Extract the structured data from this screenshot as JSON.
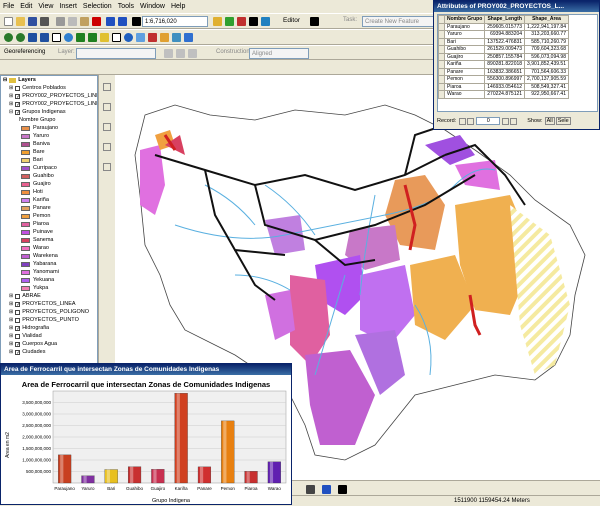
{
  "menu": [
    "File",
    "Edit",
    "View",
    "Insert",
    "Selection",
    "Tools",
    "Window",
    "Help"
  ],
  "toolbar": {
    "scale": "1:6,716,020",
    "editor": "Editor",
    "task": "Task:",
    "task_value": "Create New Feature",
    "georef": "Georeferencing",
    "layer": "Layer:",
    "construction": "Construction:",
    "construction_value": "Aligned"
  },
  "toc": {
    "layers_label": "Layers",
    "items": [
      {
        "label": "Centros Poblados",
        "checked": false
      },
      {
        "label": "PROY002_PROYECTOS_LINE",
        "checked": true
      },
      {
        "label": "PROY002_PROYECTOS_LINE",
        "checked": true
      },
      {
        "label": "Grupos Indigenas",
        "checked": true
      }
    ],
    "legend_field": "Nombre Grupo",
    "legend": [
      {
        "label": "Paraujano",
        "color": "#e8904a"
      },
      {
        "label": "Yaruro",
        "color": "#c878c8"
      },
      {
        "label": "Baniva",
        "color": "#b05090"
      },
      {
        "label": "Bare",
        "color": "#f0a030"
      },
      {
        "label": "Bari",
        "color": "#f0d070"
      },
      {
        "label": "Curripaco",
        "color": "#a050c8"
      },
      {
        "label": "Guahibo",
        "color": "#d06060"
      },
      {
        "label": "Guajiro",
        "color": "#e86090"
      },
      {
        "label": "Hoti",
        "color": "#f09040"
      },
      {
        "label": "Kariña",
        "color": "#d080f0"
      },
      {
        "label": "Panare",
        "color": "#e0a060"
      },
      {
        "label": "Pemon",
        "color": "#f0a040"
      },
      {
        "label": "Piaroa",
        "color": "#e060a0"
      },
      {
        "label": "Puinave",
        "color": "#c050e0"
      },
      {
        "label": "Sanema",
        "color": "#d84060"
      },
      {
        "label": "Warao",
        "color": "#f070c0"
      },
      {
        "label": "Warekena",
        "color": "#c060d0"
      },
      {
        "label": "Yabarana",
        "color": "#8040c0"
      },
      {
        "label": "Yanomami",
        "color": "#e070e0"
      },
      {
        "label": "Yekuana",
        "color": "#b060f0"
      },
      {
        "label": "Yukpa",
        "color": "#f080b0"
      }
    ],
    "other_layers": [
      {
        "label": "ABRAE",
        "checked": false
      },
      {
        "label": "PROYECTOS_LINEA",
        "checked": true
      },
      {
        "label": "PROYECTOS_POLIGONO",
        "checked": false
      },
      {
        "label": "PROYECTOS_PUNTO",
        "checked": false
      },
      {
        "label": "Hidrografia",
        "checked": true
      },
      {
        "label": "Vialidad",
        "checked": false
      },
      {
        "label": "Cuerpos Agua",
        "checked": true
      },
      {
        "label": "Ciudades",
        "checked": true
      }
    ]
  },
  "attributes": {
    "title": "Attributes of PROY002_PROYECTOS_L...",
    "columns": [
      "Nombre Grupo",
      "Shape_Length",
      "Shape_Area"
    ],
    "rows": [
      [
        "Paraujano",
        "259605.015773",
        "1,222,941,197.84"
      ],
      [
        "Yaruro",
        "69394.883204",
        "313,203,660.77"
      ],
      [
        "Bari",
        "137522.476831",
        "585,710,260.79"
      ],
      [
        "Guahibo",
        "261529.009473",
        "709,604,323.68"
      ],
      [
        "Guajiro",
        "250857.155784",
        "596,073,094.98"
      ],
      [
        "Kariña",
        "890281.822018",
        "3,901,852,439.51"
      ],
      [
        "Panare",
        "163832.386651",
        "701,564,606.33"
      ],
      [
        "Pemon",
        "556300.896997",
        "2,700,137,905.59"
      ],
      [
        "Piaroa",
        "146933.054612",
        "508,549,327.41"
      ],
      [
        "Warao",
        "270224.875121",
        "922,950,667.41"
      ]
    ],
    "record_label": "Record:",
    "record_value": "0",
    "show_label": "Show:",
    "show_all": "All",
    "show_selected": "Sele"
  },
  "chart_window": {
    "title": "Area de Ferrocarril que intersectan Zonas de Comunidades Indigenas"
  },
  "chart_data": {
    "type": "bar",
    "title": "Area de Ferrocarril que intersectan Zonas de Comunidades Indigenas",
    "xlabel": "Grupo Indigena",
    "ylabel": "Area en m2",
    "categories": [
      "Paraujano",
      "Yaruro",
      "Bari",
      "Guahibo",
      "Guajiro",
      "Kariña",
      "Panare",
      "Pemon",
      "Piaroa",
      "Warao"
    ],
    "values": [
      1222941197.84,
      313203660.77,
      585710260.79,
      709604323.68,
      596073094.98,
      3901852439.51,
      701564606.33,
      2700137905.59,
      508549327.41,
      922950667.41
    ],
    "colors": [
      "#c84020",
      "#8030a0",
      "#e8c020",
      "#c83030",
      "#c83050",
      "#d04020",
      "#d03030",
      "#e88010",
      "#c83030",
      "#6020b0"
    ],
    "ylim": [
      0,
      4000000000
    ],
    "yticks": [
      "500,000,000",
      "1,000,000,000",
      "1,500,000,000",
      "2,000,000,000",
      "2,500,000,000",
      "3,000,000,000",
      "3,500,000,000"
    ]
  },
  "status": {
    "coords": "1511900  1159454.24 Meters"
  }
}
